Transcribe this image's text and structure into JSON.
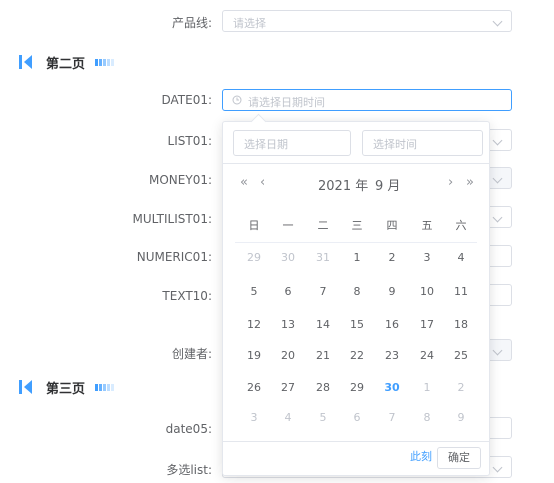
{
  "form": {
    "rows": [
      {
        "label": "产品线:",
        "placeholder": "请选择"
      },
      {
        "label": "DATE01:",
        "placeholder": "请选择日期时间"
      },
      {
        "label": "LIST01:"
      },
      {
        "label": "MONEY01:"
      },
      {
        "label": "MULTILIST01:"
      },
      {
        "label": "NUMERIC01:"
      },
      {
        "label": "TEXT10:"
      },
      {
        "label": "创建者:"
      },
      {
        "label": "date05:"
      },
      {
        "label": "多选list:"
      }
    ]
  },
  "sections": [
    {
      "title": "第二页"
    },
    {
      "title": "第三页"
    }
  ],
  "picker": {
    "date_placeholder": "选择日期",
    "time_placeholder": "选择时间",
    "year_label": "2021 年",
    "month_label": "9 月",
    "prev_year": "«",
    "prev_month": "‹",
    "next_month": "›",
    "next_year": "»",
    "weekdays": [
      "日",
      "一",
      "二",
      "三",
      "四",
      "五",
      "六"
    ],
    "weeks": [
      [
        "29",
        "30",
        "31",
        "1",
        "2",
        "3",
        "4"
      ],
      [
        "5",
        "6",
        "7",
        "8",
        "9",
        "10",
        "11"
      ],
      [
        "12",
        "13",
        "14",
        "15",
        "16",
        "17",
        "18"
      ],
      [
        "19",
        "20",
        "21",
        "22",
        "23",
        "24",
        "25"
      ],
      [
        "26",
        "27",
        "28",
        "29",
        "30",
        "1",
        "2"
      ],
      [
        "3",
        "4",
        "5",
        "6",
        "7",
        "8",
        "9"
      ]
    ],
    "now_label": "此刻",
    "confirm_label": "确定",
    "highlight_color": "#409eff"
  }
}
